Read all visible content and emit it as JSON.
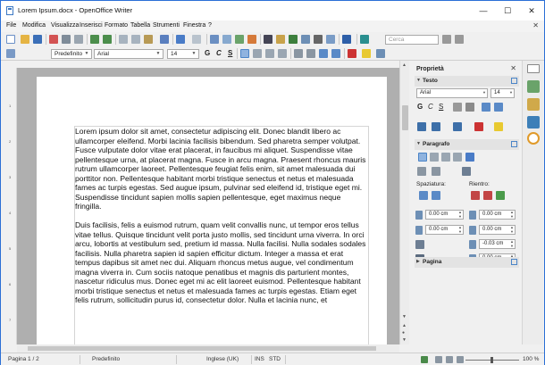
{
  "window": {
    "title": "Lorem Ipsum.docx - OpenOffice Writer",
    "minimize": "—",
    "maximize": "☐",
    "close": "✕"
  },
  "menu": {
    "items": [
      "File",
      "Modifica",
      "Visualizza",
      "Inserisci",
      "Formato",
      "Tabella",
      "Strumenti",
      "Finestra",
      "?"
    ],
    "close": "✕"
  },
  "toolbar": {
    "search_placeholder": "Cerca"
  },
  "formatting": {
    "style": "Predefinito",
    "font": "Arial",
    "size": "14",
    "bold": "G",
    "italic": "C",
    "underline": "S"
  },
  "document": {
    "paragraph1": "Lorem ipsum dolor sit amet, consectetur adipiscing elit. Donec blandit libero ac ullamcorper eleifend. Morbi lacinia facilisis bibendum. Sed pharetra semper volutpat. Fusce vulputate dolor vitae erat placerat, in faucibus mi aliquet. Suspendisse vitae pellentesque urna, at placerat magna. Fusce in arcu magna. Praesent rhoncus mauris rutrum ullamcorper laoreet. Pellentesque feugiat felis enim, sit amet malesuada dui porttitor non. Pellentesque habitant morbi tristique senectus et netus et malesuada fames ac turpis egestas. Sed augue ipsum, pulvinar sed eleifend id, tristique eget mi. Suspendisse tincidunt sapien mollis sapien pellentesque, eget maximus neque fringilla.",
    "paragraph2": "Duis facilisis, felis a euismod rutrum, quam velit convallis nunc, ut tempor eros tellus vitae tellus. Quisque tincidunt velit porta justo mollis, sed tincidunt urna viverra. In orci arcu, lobortis at vestibulum sed, pretium id massa. Nulla facilisi. Nulla sodales sodales facilisis. Nulla pharetra sapien id sapien efficitur dictum. Integer a massa et erat tempus dapibus sit amet nec dui. Aliquam rhoncus metus augue, vel condimentum magna viverra in. Cum sociis natoque penatibus et magnis dis parturient montes, nascetur ridiculus mus. Donec eget mi ac elit laoreet euismod. Pellentesque habitant morbi tristique senectus et netus et malesuada fames ac turpis egestas. Etiam eget felis rutrum, sollicitudin purus id, consectetur dolor. Nulla et lacinia nunc, et"
  },
  "sidebar": {
    "title": "Proprietà",
    "close": "✕",
    "sections": {
      "text": "Testo",
      "paragraph": "Paragrafo",
      "page": "Pagina"
    },
    "font": "Arial",
    "size": "14",
    "spacing_label": "Spaziatura:",
    "indent_label": "Rientro:",
    "field_values": [
      "0.00 cm",
      "0.00 cm",
      "0.00 cm",
      "0.00 cm",
      "-0.03 cm",
      "0.00 cm"
    ]
  },
  "status": {
    "page": "Pagina 1 / 2",
    "style": "Predefinito",
    "language": "Inglese (UK)",
    "insert": "INS",
    "select": "STD",
    "zoom": "100 %"
  },
  "colors": {
    "accent": "#2b6fd6",
    "doc_background": "#afafaf",
    "spell_error": "#e03030"
  }
}
